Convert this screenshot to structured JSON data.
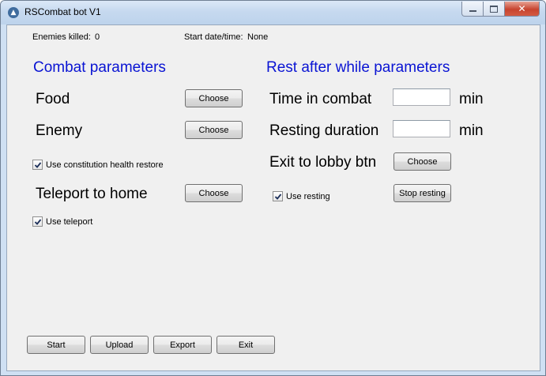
{
  "window": {
    "title": "RSCombat bot V1"
  },
  "status": {
    "enemies_killed_label": "Enemies killed:",
    "enemies_killed_value": "0",
    "start_label": "Start date/time:",
    "start_value": "None"
  },
  "combat": {
    "heading": "Combat parameters",
    "food_label": "Food",
    "enemy_label": "Enemy",
    "teleport_label": "Teleport to home",
    "choose_label": "Choose",
    "constitution_label": "Use constitution health restore",
    "constitution_checked": true,
    "use_teleport_label": "Use teleport",
    "use_teleport_checked": true
  },
  "rest": {
    "heading": "Rest after while parameters",
    "time_label": "Time in combat",
    "time_value": "",
    "resting_label": "Resting duration",
    "resting_value": "",
    "min_label": "min",
    "exit_label": "Exit to lobby btn",
    "choose_label": "Choose",
    "use_resting_label": "Use resting",
    "use_resting_checked": true,
    "stop_label": "Stop resting"
  },
  "footer": {
    "start": "Start",
    "upload": "Upload",
    "export": "Export",
    "exit": "Exit"
  },
  "colors": {
    "heading": "#0a14d3",
    "client_bg": "#f0f0f0"
  }
}
